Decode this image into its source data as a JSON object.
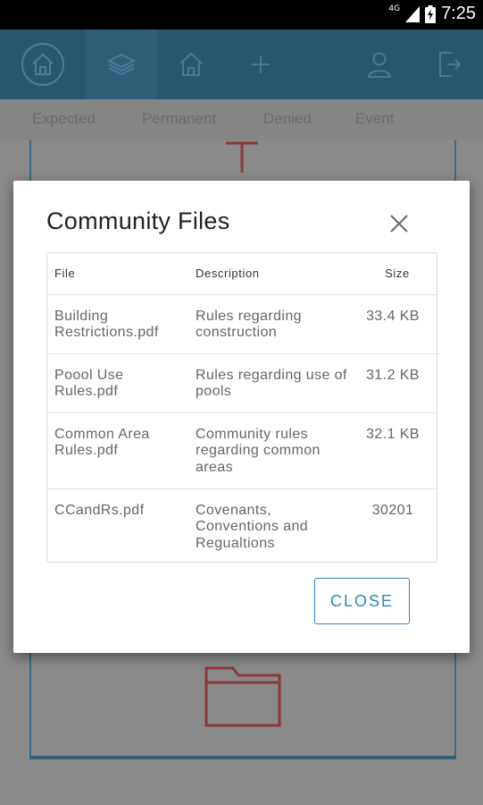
{
  "status_bar": {
    "time": "7:25",
    "network": "4G"
  },
  "app_bar": {
    "items": [
      "home-circle-icon",
      "layers-icon",
      "home-icon",
      "plus-icon",
      "user-icon",
      "logout-icon"
    ]
  },
  "tabs": [
    "Expected",
    "Permanent",
    "Denied",
    "Event"
  ],
  "dialog": {
    "title": "Community Files",
    "columns": {
      "file": "File",
      "description": "Description",
      "size": "Size"
    },
    "rows": [
      {
        "file": "Building Restrictions.pdf",
        "description": "Rules regarding construction",
        "size": "33.4 KB"
      },
      {
        "file": "Poool Use Rules.pdf",
        "description": "Rules regarding use of pools",
        "size": "31.2 KB"
      },
      {
        "file": "Common Area Rules.pdf",
        "description": "Community rules regarding common areas",
        "size": "32.1 KB"
      },
      {
        "file": "CCandRs.pdf",
        "description": "Covenants, Conventions and Regualtions",
        "size": "30201"
      }
    ],
    "close_label": "CLOSE"
  },
  "colors": {
    "accent": "#2f86b6",
    "app_bar": "#2a5670",
    "background_icon": "#8b3a3a"
  }
}
